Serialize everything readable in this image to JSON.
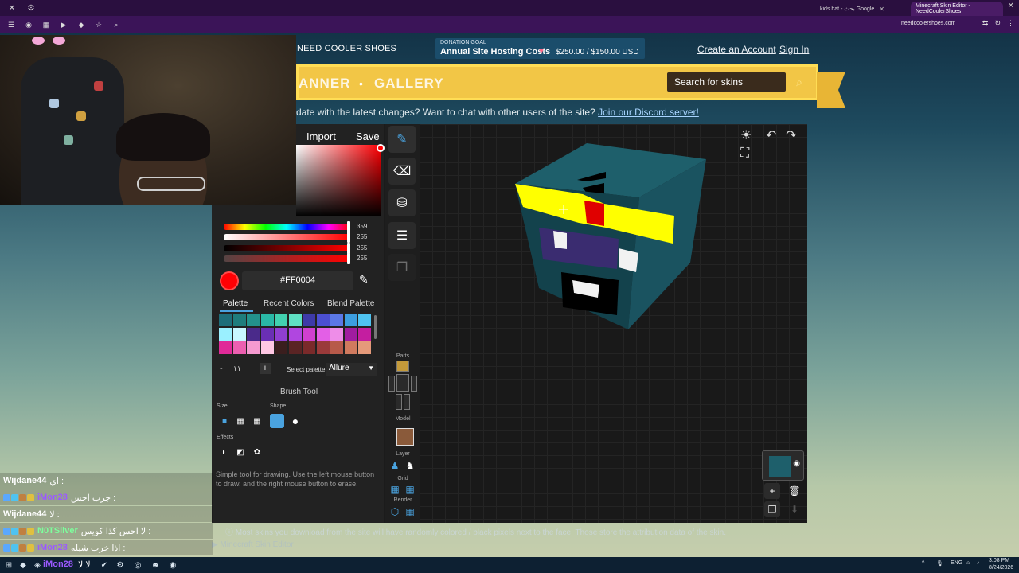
{
  "browser": {
    "tabs": [
      {
        "label": "kids hat - بحث Google"
      },
      {
        "label": "Minecraft Skin Editor - NeedCoolerShoes"
      }
    ],
    "url": "needcoolershoes.com"
  },
  "site": {
    "name": "NEED COOLER SHOES",
    "donation": {
      "label": "DONATION GOAL",
      "title": "Annual Site Hosting Costs",
      "amount": "$250.00 / $150.00 USD"
    },
    "create_account": "Create an Account",
    "sign_in": "Sign In",
    "nav_banner": "ANNER",
    "nav_gallery": "GALLERY",
    "search_placeholder": "Search for skins",
    "discord_prefix": "date with the latest changes? Want to chat with other users of the site?",
    "discord_link": "Join our Discord server!"
  },
  "editor": {
    "import_label": "Import",
    "save_label": "Save",
    "color": {
      "hex": "#FF0004",
      "hue": "359",
      "saturation": "255",
      "value": "255",
      "alpha": "255"
    },
    "palette_tabs": [
      "Palette",
      "Recent Colors",
      "Blend Palette"
    ],
    "palette_count": "١١",
    "select_palette_label": "Select palette",
    "selected_palette": "Allure",
    "brush_tool_title": "Brush Tool",
    "size_label": "Size",
    "shape_label": "Shape",
    "effects_label": "Effects",
    "tool_description": "Simple tool for drawing. Use the left mouse button to draw, and the right mouse button to erase.",
    "side_labels": {
      "parts": "Parts",
      "model": "Model",
      "layer": "Layer",
      "grid": "Grid",
      "render": "Render"
    },
    "footer_note": "Most skins you download from the site will have randomly colored / black pixels next to the face. Those store the attribution data of the skin.",
    "footer_title": "Minecraft Skin Editor"
  },
  "palette_colors": [
    "#1e6e7a",
    "#1f7d7d",
    "#23928c",
    "#2ab8a6",
    "#42d1b0",
    "#5fe0c3",
    "#3e3aa8",
    "#4b4fd1",
    "#5b78e6",
    "#3c9ee0",
    "#4fc3f0",
    "#9af0ff",
    "#c8f7ff",
    "#4a2a8a",
    "#6a2fb5",
    "#8f3fd1",
    "#b046e0",
    "#d040d0",
    "#e35fe6",
    "#ee8de8",
    "#a01ca0",
    "#c41ea0",
    "#e02a98",
    "#ec5fb0",
    "#f59ad0",
    "#ffc8e4",
    "#3a1e1e",
    "#5a2424",
    "#7a2a2a",
    "#9a3a3a",
    "#b75a4a",
    "#d07a5e",
    "#e59a7a"
  ],
  "chat": [
    {
      "user": "Wijdane44",
      "message": "اي :",
      "color": "#ffffff"
    },
    {
      "user": "iMon28",
      "message": "جرب احس :",
      "color": "#9b59ff"
    },
    {
      "user": "Wijdane44",
      "message": "لا :",
      "color": "#ffffff"
    },
    {
      "user": "N0TSilver",
      "message": "لا احس كذا كويس :",
      "color": "#7dff9c"
    },
    {
      "user": "iMon28",
      "message": "اذا خرب شيله :",
      "color": "#9b59ff"
    }
  ],
  "taskbar": {
    "user": "iMon28",
    "message": "لا لا",
    "lang": "ENG",
    "time": "3:08 PM",
    "date": "8/24/2026"
  }
}
